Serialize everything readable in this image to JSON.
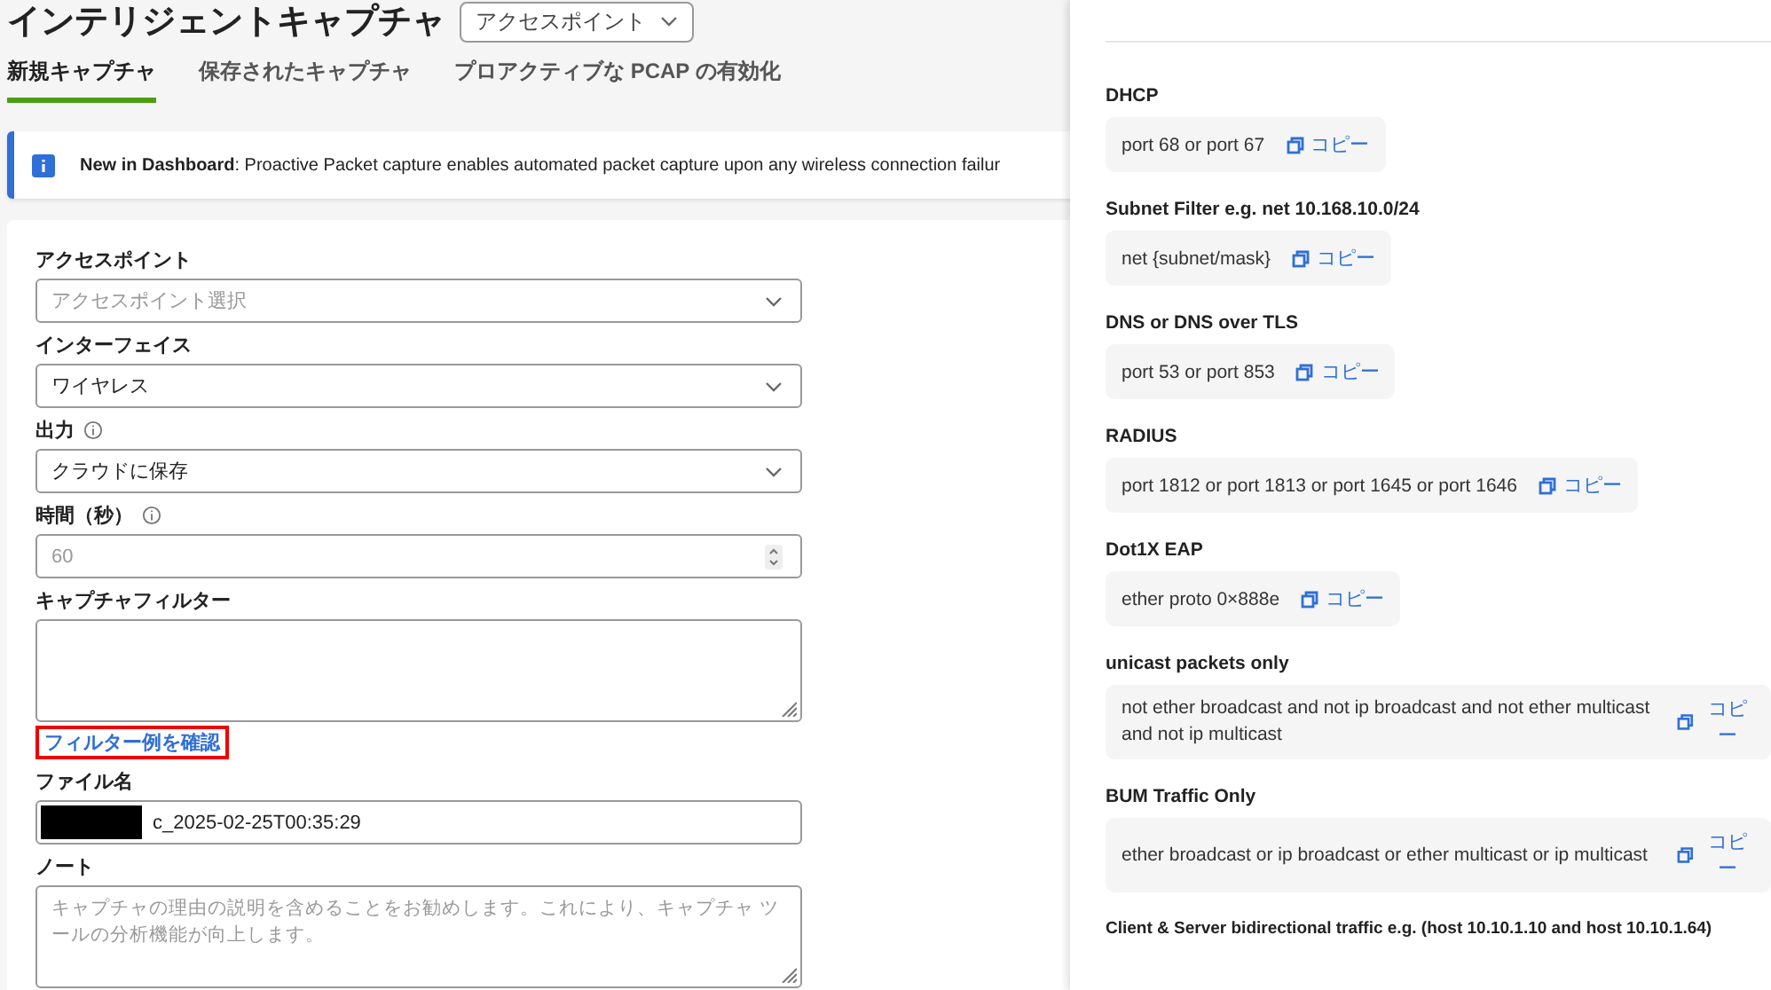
{
  "header": {
    "title": "インテリジェントキャプチャ",
    "dropdown": "アクセスポイント"
  },
  "tabs": [
    {
      "label": "新規キャプチャ",
      "selected": true
    },
    {
      "label": "保存されたキャプチャ",
      "selected": false
    },
    {
      "label": "プロアクティブな PCAP の有効化",
      "selected": false
    }
  ],
  "banner": {
    "text": "**New in Dashboard**: Proactive Packet capture enables automated packet capture upon any wireless connection failur"
  },
  "form": [
    {
      "kind": "select",
      "label": "アクセスポイント",
      "info": false,
      "placeholder": "アクセスポイント選択"
    },
    {
      "kind": "select",
      "label": "インターフェイス",
      "info": false,
      "value": "ワイヤレス"
    },
    {
      "kind": "select",
      "label": "出力",
      "info": true,
      "value": "クラウドに保存"
    },
    {
      "kind": "number",
      "label": "時間（秒）",
      "info": true,
      "placeholder": "60"
    },
    {
      "kind": "textarea",
      "label": "キャプチャフィルター",
      "info": false,
      "link": "フィルター例を確認"
    },
    {
      "kind": "text",
      "label": "ファイル名",
      "info": false,
      "redacted": true,
      "value": "c_2025-02-25T00:35:29"
    },
    {
      "kind": "textarea",
      "label": "ノート",
      "info": false,
      "placeholder": "キャプチャの理由の説明を含めることをお勧めします。これにより、キャプチャ ツールの分析機能が向上します。"
    }
  ],
  "filter_examples": [
    {
      "kind": "inline",
      "title": "DHCP",
      "filter": "port 68 or port 67",
      "copy": "コピー"
    },
    {
      "kind": "inline",
      "title": "Subnet Filter e.g. net 10.168.10.0/24",
      "filter": "net {subnet/mask}",
      "copy": "コピー"
    },
    {
      "kind": "inline",
      "title": "DNS or DNS over TLS",
      "filter": "port 53 or port 853",
      "copy": "コピー"
    },
    {
      "kind": "inline",
      "title": "RADIUS",
      "filter": "port 1812 or port 1813 or port 1645 or port 1646",
      "copy": "コピー"
    },
    {
      "kind": "inline",
      "title": "Dot1X EAP",
      "filter": "ether proto 0×888e",
      "copy": "コピー"
    },
    {
      "kind": "wrapped",
      "title": "unicast packets only",
      "filter": "not ether broadcast and not ip broadcast and not ether multicast and not ip multicast",
      "copy": "コピー"
    },
    {
      "kind": "wrapped",
      "title": "BUM Traffic Only",
      "filter": "ether broadcast or ip broadcast or ether multicast or ip multicast",
      "copy": "コピー"
    },
    {
      "kind": "title_only",
      "title": "Client & Server bidirectional traffic e.g. (host 10.10.1.10 and host 10.10.1.64)"
    }
  ]
}
